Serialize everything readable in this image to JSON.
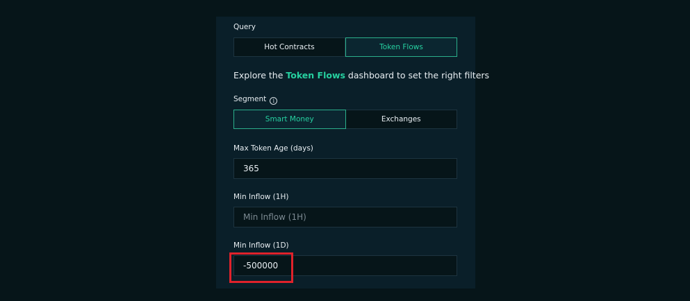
{
  "query": {
    "label": "Query",
    "options": [
      "Hot Contracts",
      "Token Flows"
    ],
    "selected": "Token Flows"
  },
  "explore": {
    "prefix": "Explore the ",
    "highlight": "Token Flows",
    "suffix": " dashboard to set the right filters"
  },
  "segment": {
    "label": "Segment",
    "info_icon": "i",
    "options": [
      "Smart Money",
      "Exchanges"
    ],
    "selected": "Smart Money"
  },
  "max_token_age": {
    "label": "Max Token Age (days)",
    "value": "365",
    "placeholder": ""
  },
  "min_inflow_1h": {
    "label": "Min Inflow (1H)",
    "value": "",
    "placeholder": "Min Inflow (1H)"
  },
  "min_inflow_1d": {
    "label": "Min Inflow (1D)",
    "value": "-500000",
    "placeholder": ""
  },
  "colors": {
    "background": "#061519",
    "panel": "#0a1f29",
    "accent": "#26d0a0",
    "highlight_box": "#e0222b"
  }
}
